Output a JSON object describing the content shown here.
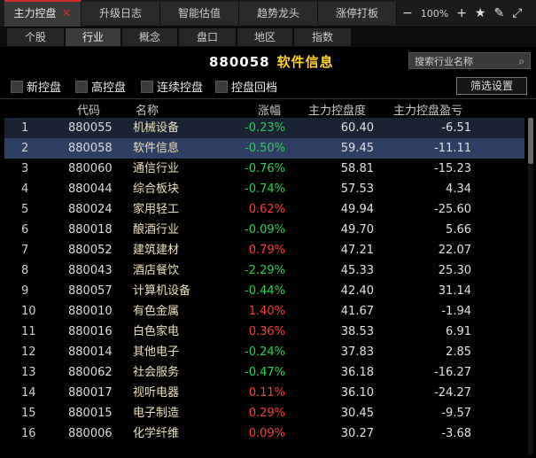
{
  "tabs": [
    {
      "label": "主力控盘",
      "active": true
    },
    {
      "label": "升级日志"
    },
    {
      "label": "智能估值"
    },
    {
      "label": "趋势龙头"
    },
    {
      "label": "涨停打板"
    }
  ],
  "tab_close": "✕",
  "toolbar": {
    "zoom": "100%",
    "minus": "−",
    "plus": "+",
    "star": "★",
    "edit": "✎",
    "expand": "⤢"
  },
  "subtabs": [
    {
      "label": "个股"
    },
    {
      "label": "行业",
      "active": true
    },
    {
      "label": "概念"
    },
    {
      "label": "盘口"
    },
    {
      "label": "地区"
    },
    {
      "label": "指数"
    }
  ],
  "header": {
    "code": "880058",
    "name": "软件信息"
  },
  "search": {
    "placeholder": "搜索行业名称",
    "icon": "search-icon"
  },
  "filters": [
    {
      "label": "新控盘"
    },
    {
      "label": "高控盘"
    },
    {
      "label": "连续控盘"
    },
    {
      "label": "控盘回档"
    }
  ],
  "filter_button": "筛选设置",
  "columns": [
    "代码",
    "名称",
    "涨幅",
    "主力控盘度",
    "主力控盘盈亏"
  ],
  "rows": [
    {
      "idx": "1",
      "code": "880055",
      "name": "机械设备",
      "chg": "-0.23%",
      "ctrl": "60.40",
      "pnl": "-6.51"
    },
    {
      "idx": "2",
      "code": "880058",
      "name": "软件信息",
      "chg": "-0.50%",
      "ctrl": "59.45",
      "pnl": "-11.11"
    },
    {
      "idx": "3",
      "code": "880060",
      "name": "通信行业",
      "chg": "-0.76%",
      "ctrl": "58.81",
      "pnl": "-15.23"
    },
    {
      "idx": "4",
      "code": "880044",
      "name": "综合板块",
      "chg": "-0.74%",
      "ctrl": "57.53",
      "pnl": "4.34"
    },
    {
      "idx": "5",
      "code": "880024",
      "name": "家用轻工",
      "chg": "0.62%",
      "ctrl": "49.94",
      "pnl": "-25.60"
    },
    {
      "idx": "6",
      "code": "880018",
      "name": "酿酒行业",
      "chg": "-0.09%",
      "ctrl": "49.70",
      "pnl": "5.66"
    },
    {
      "idx": "7",
      "code": "880052",
      "name": "建筑建材",
      "chg": "0.79%",
      "ctrl": "47.21",
      "pnl": "22.07"
    },
    {
      "idx": "8",
      "code": "880043",
      "name": "酒店餐饮",
      "chg": "-2.29%",
      "ctrl": "45.33",
      "pnl": "25.30"
    },
    {
      "idx": "9",
      "code": "880057",
      "name": "计算机设备",
      "chg": "-0.44%",
      "ctrl": "42.40",
      "pnl": "31.14"
    },
    {
      "idx": "10",
      "code": "880010",
      "name": "有色金属",
      "chg": "1.40%",
      "ctrl": "41.67",
      "pnl": "-1.94"
    },
    {
      "idx": "11",
      "code": "880016",
      "name": "白色家电",
      "chg": "0.36%",
      "ctrl": "38.53",
      "pnl": "6.91"
    },
    {
      "idx": "12",
      "code": "880014",
      "name": "其他电子",
      "chg": "-0.24%",
      "ctrl": "37.83",
      "pnl": "2.85"
    },
    {
      "idx": "13",
      "code": "880062",
      "name": "社会服务",
      "chg": "-0.47%",
      "ctrl": "36.18",
      "pnl": "-16.27"
    },
    {
      "idx": "14",
      "code": "880017",
      "name": "视听电器",
      "chg": "0.11%",
      "ctrl": "36.10",
      "pnl": "-24.27"
    },
    {
      "idx": "15",
      "code": "880015",
      "name": "电子制造",
      "chg": "0.29%",
      "ctrl": "30.45",
      "pnl": "-9.57"
    },
    {
      "idx": "16",
      "code": "880006",
      "name": "化学纤维",
      "chg": "0.09%",
      "ctrl": "30.27",
      "pnl": "-3.68"
    }
  ],
  "colors": {
    "up": "#ff3b3b",
    "down": "#26d056",
    "accent": "#d62a2a",
    "title_name": "#ffd21f"
  }
}
